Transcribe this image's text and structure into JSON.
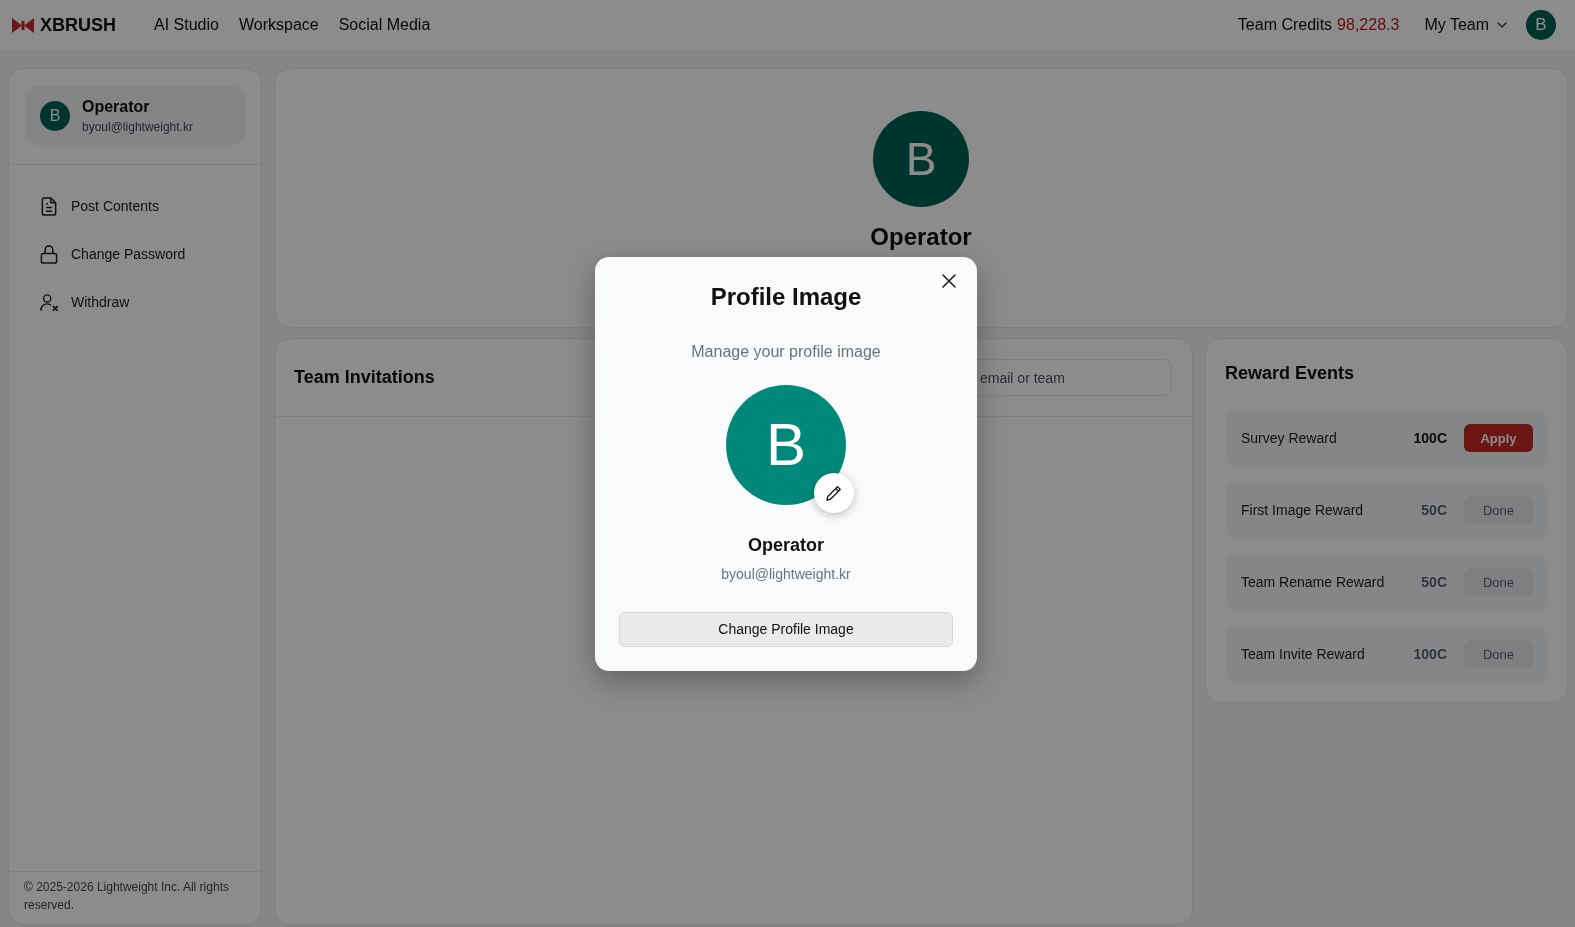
{
  "header": {
    "logo": "XBRUSH",
    "nav": [
      {
        "label": "AI Studio"
      },
      {
        "label": "Workspace"
      },
      {
        "label": "Social Media"
      }
    ],
    "credits_label": "Team Credits",
    "credits_value": "98,228.3",
    "team_menu": "My Team",
    "avatar_initial": "B"
  },
  "sidebar": {
    "profile": {
      "initial": "B",
      "name": "Operator",
      "email": "byoul@lightweight.kr"
    },
    "menu": [
      {
        "label": "Post Contents"
      },
      {
        "label": "Change Password"
      },
      {
        "label": "Withdraw"
      }
    ],
    "footer": "© 2025-2026 Lightweight Inc. All rights reserved."
  },
  "profile": {
    "initial": "B",
    "name": "Operator"
  },
  "team_invitations": {
    "title": "Team Invitations",
    "search": {
      "placeholder": "email or team"
    }
  },
  "reward_events": {
    "title": "Reward Events",
    "events": [
      {
        "name": "Survey Reward",
        "amount": "100C",
        "button": "Apply",
        "disabled": false
      },
      {
        "name": "First Image Reward",
        "amount": "50C",
        "button": "Done",
        "disabled": true
      },
      {
        "name": "Team Rename Reward",
        "amount": "50C",
        "button": "Done",
        "disabled": true
      },
      {
        "name": "Team Invite Reward",
        "amount": "100C",
        "button": "Done",
        "disabled": true
      }
    ]
  },
  "dialog": {
    "title": "Profile Image",
    "subtitle": "Manage your profile image",
    "initial": "B",
    "name": "Operator",
    "email": "byoul@lightweight.kr",
    "button": "Change Profile Image"
  }
}
